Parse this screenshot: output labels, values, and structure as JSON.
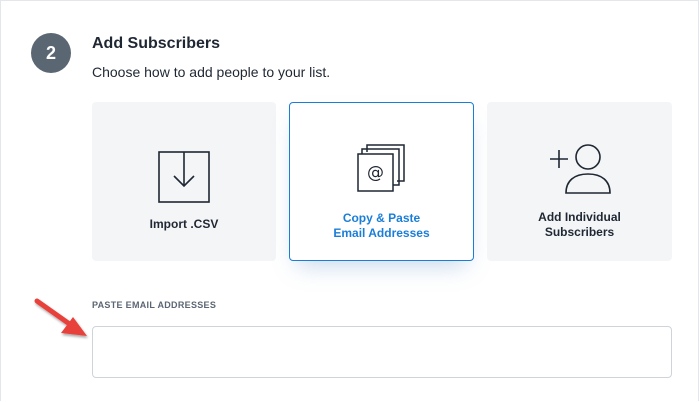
{
  "step": {
    "number": "2",
    "title": "Add Subscribers",
    "subtitle": "Choose how to add people to your list."
  },
  "options": [
    {
      "id": "import-csv",
      "label": "Import .CSV",
      "icon": "download-icon",
      "selected": false
    },
    {
      "id": "copy-paste",
      "label_line1": "Copy & Paste",
      "label_line2": "Email Addresses",
      "icon": "at-documents-icon",
      "selected": true
    },
    {
      "id": "add-individual",
      "label_line1": "Add Individual",
      "label_line2": "Subscribers",
      "icon": "add-person-icon",
      "selected": false
    }
  ],
  "paste_field": {
    "label": "PASTE EMAIL ADDRESSES",
    "value": "",
    "placeholder": ""
  },
  "colors": {
    "accent": "#1a7ed8",
    "badge": "#5b6673",
    "annotation_arrow": "#e8403a"
  }
}
